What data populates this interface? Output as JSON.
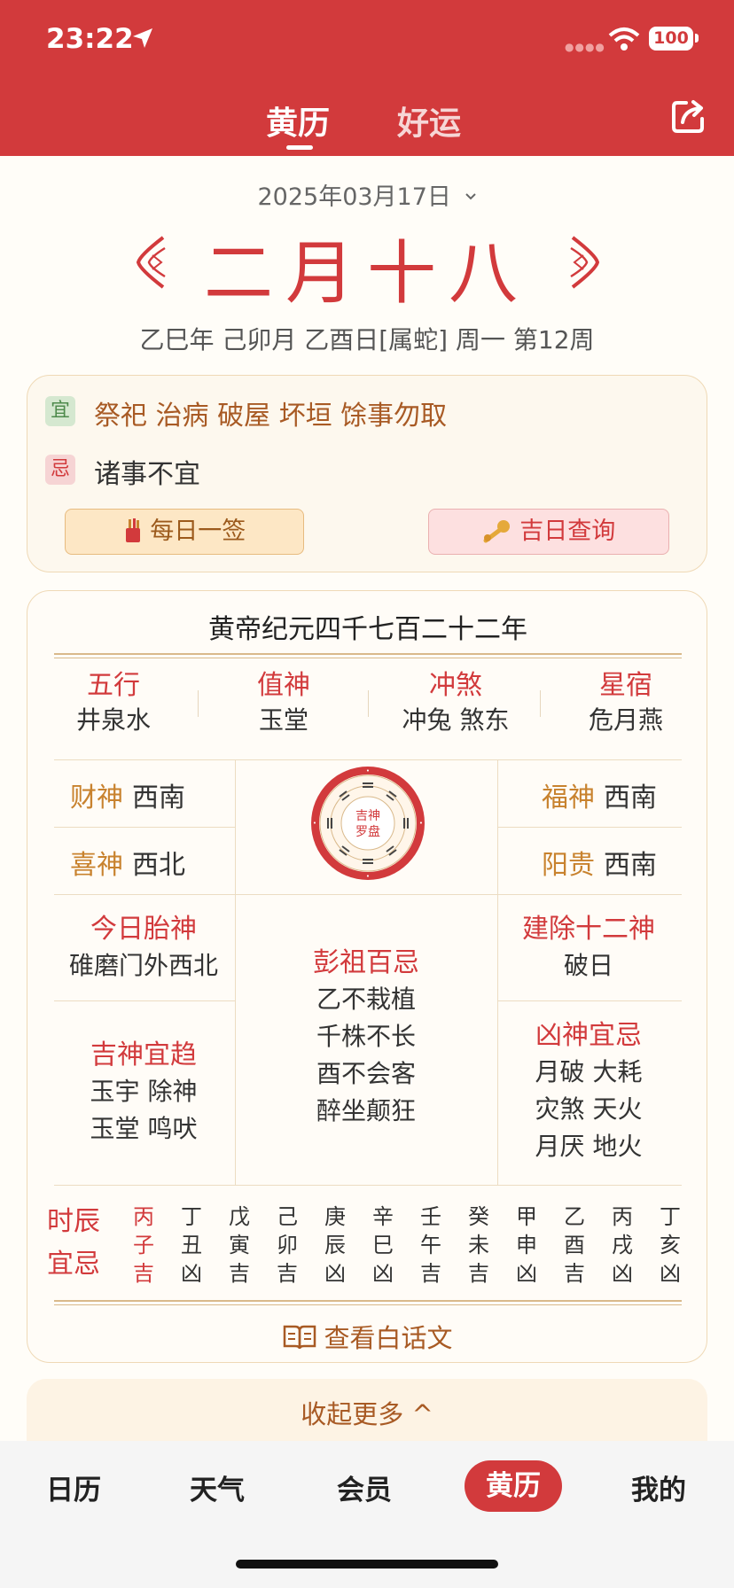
{
  "status_bar": {
    "time": "23:22",
    "battery": "100"
  },
  "header": {
    "tabs": [
      {
        "label": "黄历"
      },
      {
        "label": "好运"
      }
    ]
  },
  "date_selector": {
    "label": "2025年03月17日"
  },
  "lunar": {
    "date": "二月十八",
    "ganzhi_line": "乙巳年 己卯月 乙酉日[属蛇] 周一 第12周"
  },
  "yiji": {
    "yi_tag": "宜",
    "yi": "祭祀 治病 破屋 坏垣 馀事勿取",
    "ji_tag": "忌",
    "ji": "诸事不宜",
    "daily_sign": "每日一签",
    "auspicious_query": "吉日查询"
  },
  "almanac": {
    "era": "黄帝纪元四千七百二十二年",
    "wuxing": [
      {
        "head": "五行",
        "value": "井泉水"
      },
      {
        "head": "值神",
        "value": "玉堂"
      },
      {
        "head": "冲煞",
        "value": "冲兔 煞东"
      },
      {
        "head": "星宿",
        "value": "危月燕"
      }
    ],
    "gods": {
      "caishen": {
        "label": "财神",
        "value": "西南"
      },
      "xishen": {
        "label": "喜神",
        "value": "西北"
      },
      "fushen": {
        "label": "福神",
        "value": "西南"
      },
      "yanggui": {
        "label": "阳贵",
        "value": "西南"
      }
    },
    "compass": {
      "line1": "吉神",
      "line2": "罗盘"
    },
    "taishen": {
      "head": "今日胎神",
      "value": "碓磨门外西北"
    },
    "jianchu": {
      "head": "建除十二神",
      "value": "破日"
    },
    "pengzu": {
      "head": "彭祖百忌",
      "lines": [
        "乙不栽植",
        "千株不长",
        "酉不会客",
        "醉坐颠狂"
      ]
    },
    "jishen": {
      "head": "吉神宜趋",
      "lines": [
        "玉宇 除神",
        "玉堂 鸣吠"
      ]
    },
    "xiongshen": {
      "head": "凶神宜忌",
      "lines": [
        "月破 大耗",
        "灾煞 天火",
        "月厌 地火"
      ]
    },
    "hours_label": {
      "line1": "时辰",
      "line2": "宜忌"
    },
    "hours": [
      {
        "gan": "丙",
        "zhi": "子",
        "luck": "吉"
      },
      {
        "gan": "丁",
        "zhi": "丑",
        "luck": "凶"
      },
      {
        "gan": "戊",
        "zhi": "寅",
        "luck": "吉"
      },
      {
        "gan": "己",
        "zhi": "卯",
        "luck": "吉"
      },
      {
        "gan": "庚",
        "zhi": "辰",
        "luck": "凶"
      },
      {
        "gan": "辛",
        "zhi": "巳",
        "luck": "凶"
      },
      {
        "gan": "壬",
        "zhi": "午",
        "luck": "吉"
      },
      {
        "gan": "癸",
        "zhi": "未",
        "luck": "吉"
      },
      {
        "gan": "甲",
        "zhi": "申",
        "luck": "凶"
      },
      {
        "gan": "乙",
        "zhi": "酉",
        "luck": "吉"
      },
      {
        "gan": "丙",
        "zhi": "戌",
        "luck": "凶"
      },
      {
        "gan": "丁",
        "zhi": "亥",
        "luck": "凶"
      }
    ],
    "vernacular_link": "查看白话文"
  },
  "collapse": {
    "label": "收起更多 ^"
  },
  "tabbar": {
    "items": [
      {
        "label": "日历"
      },
      {
        "label": "天气"
      },
      {
        "label": "会员"
      },
      {
        "label": "黄历"
      },
      {
        "label": "我的"
      }
    ]
  },
  "colors": {
    "primary": "#d23a3c",
    "gold": "#c8822e",
    "brown": "#a85a24",
    "card": "#fdf8ee"
  }
}
